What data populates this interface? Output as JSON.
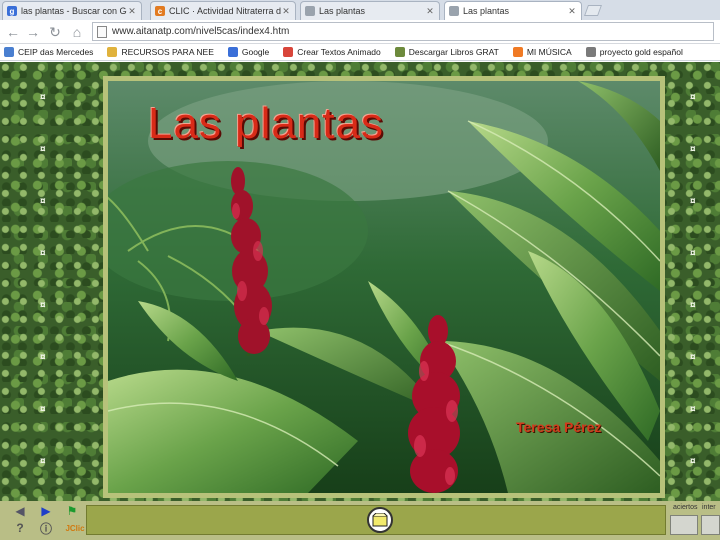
{
  "browser": {
    "tabs": [
      {
        "title": "las plantas - Buscar con Goog",
        "favicon": "google-icon",
        "favicon_color": "#3a6fd8",
        "active": false
      },
      {
        "title": "CLIC · Actividad Nitraterra de Loroto",
        "favicon": "clic-icon",
        "favicon_color": "#e27b22",
        "active": false
      },
      {
        "title": "Las plantas",
        "favicon": "page-icon",
        "favicon_color": "#9aa3ad",
        "active": false
      },
      {
        "title": "Las plantas",
        "favicon": "page-icon",
        "favicon_color": "#9aa3ad",
        "active": true
      }
    ],
    "url": "www.aitanatp.com/nivel5cas/index4.htm",
    "bookmarks": [
      {
        "label": "CEIP das Mercedes",
        "color": "#4a7fd0"
      },
      {
        "label": "RECURSOS PARA NEE",
        "color": "#e0b23c"
      },
      {
        "label": "Google",
        "color": "#3a6fd8"
      },
      {
        "label": "Crear Textos Animado",
        "color": "#d8453a"
      },
      {
        "label": "Descargar Libros GRAT",
        "color": "#6d8a3c"
      },
      {
        "label": "MI MÚSICA",
        "color": "#f07a24"
      },
      {
        "label": "proyecto gold español",
        "color": "#7a7a7a"
      }
    ]
  },
  "activity": {
    "title": "Las plantas",
    "author": "Teresa Pérez"
  },
  "jclic": {
    "icons": [
      "arrow-left-icon",
      "arrow-right-icon",
      "flag-icon",
      "help-icon",
      "info-icon",
      "jclic-logo"
    ],
    "logo_text": "JClic",
    "counters": [
      {
        "label": "aciertos",
        "value": ""
      },
      {
        "label": "inter",
        "value": ""
      }
    ],
    "colors": {
      "bar": "#b9be86",
      "message_box": "#9ba64b"
    }
  }
}
